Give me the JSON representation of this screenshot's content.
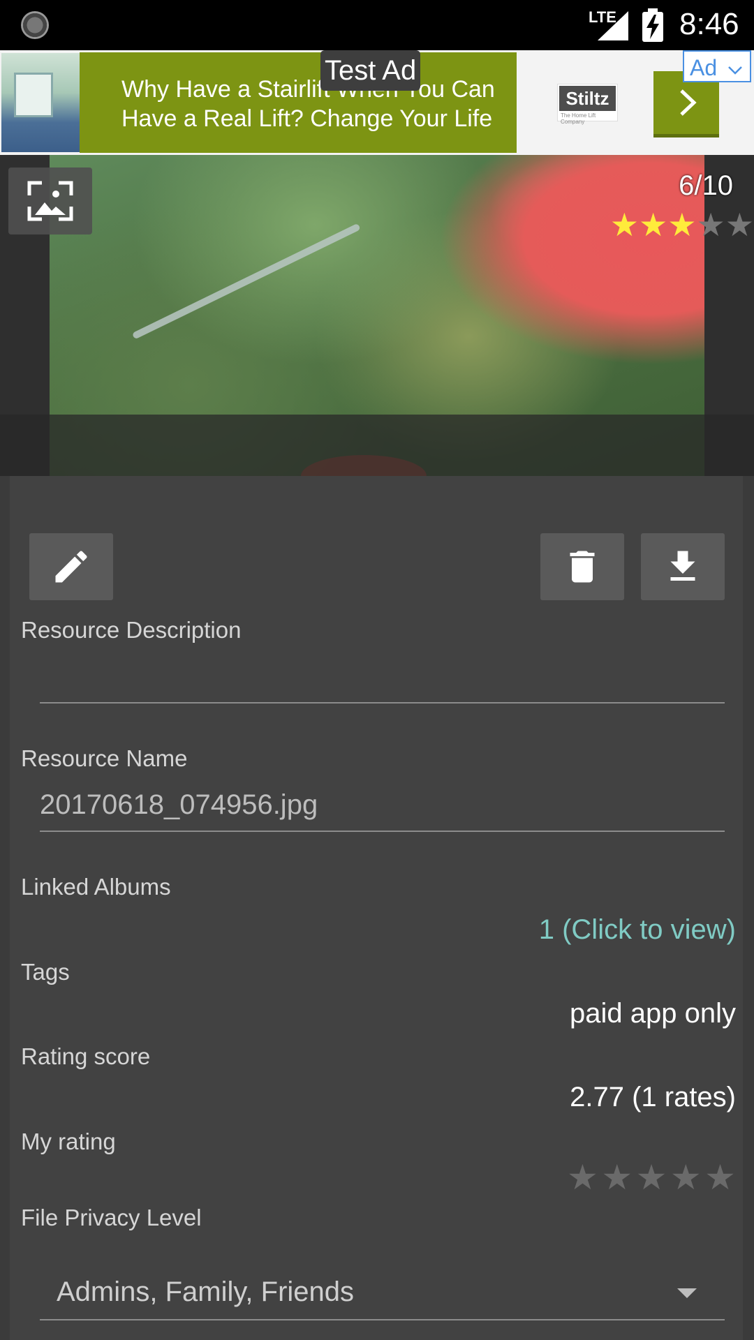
{
  "status_bar": {
    "network": "LTE",
    "time": "8:46"
  },
  "ad": {
    "test_label": "Test Ad",
    "headline": "Why Have a Stairlift When You Can Have a Real Lift? Change Your Life",
    "brand": "Stiltz",
    "brand_sub": "The Home Lift Company",
    "choice_label": "Ad"
  },
  "viewer": {
    "counter": "6/10",
    "rating_stars": {
      "filled": 3,
      "total": 5
    },
    "colors": {
      "star_filled": "#ffeb3b",
      "star_empty": "#777777"
    }
  },
  "details": {
    "description_label": "Resource Description",
    "description_value": "",
    "name_label": "Resource Name",
    "name_value": "20170618_074956.jpg",
    "linked_albums_label": "Linked Albums",
    "linked_albums_value": "1 (Click to view)",
    "tags_label": "Tags",
    "tags_value": "paid app only",
    "rating_score_label": "Rating score",
    "rating_score_value": "2.77 (1 rates)",
    "my_rating_label": "My rating",
    "my_rating_stars": {
      "filled": 0,
      "total": 5
    },
    "privacy_label": "File Privacy Level",
    "privacy_value": "Admins, Family, Friends",
    "accent_link_color": "#80cbc4"
  }
}
